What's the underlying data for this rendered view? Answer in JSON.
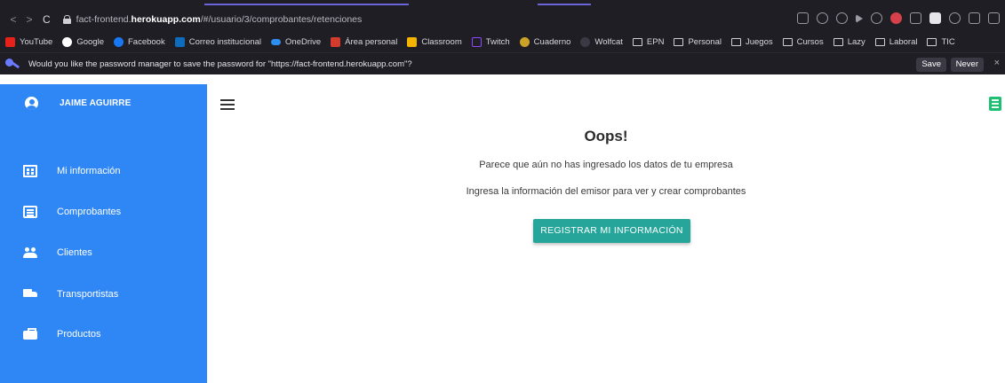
{
  "browser": {
    "url_prefix": "fact-frontend.",
    "url_domain": "herokuapp.com",
    "url_path": "/#/usuario/3/comprobantes/retenciones",
    "bookmarks": [
      "YouTube",
      "Google",
      "Facebook",
      "Correo institucional",
      "OneDrive",
      "Área personal",
      "Classroom",
      "Twitch",
      "Cuaderno",
      "Wolfcat"
    ],
    "bookmark_folders": [
      "EPN",
      "Personal",
      "Juegos",
      "Cursos",
      "Lazy",
      "Laboral",
      "TIC"
    ],
    "password_prompt": "Would you like the password manager to save the password for \"https://fact-frontend.herokuapp.com\"?",
    "save_label": "Save",
    "never_label": "Never",
    "close_glyph": "×",
    "back_glyph": "<",
    "forward_glyph": ">",
    "reload_glyph": "C"
  },
  "sidebar": {
    "user_name": "JAIME AGUIRRE",
    "items": [
      {
        "label": "Mi información",
        "icon": "building-icon"
      },
      {
        "label": "Comprobantes",
        "icon": "document-icon"
      },
      {
        "label": "Clientes",
        "icon": "people-icon"
      },
      {
        "label": "Transportistas",
        "icon": "truck-icon"
      },
      {
        "label": "Productos",
        "icon": "briefcase-icon"
      }
    ]
  },
  "main": {
    "title": "Oops!",
    "message_1": "Parece que aún no has ingresado los datos de tu empresa",
    "message_2": "Ingresa la información del emisor para ver y crear comprobantes",
    "register_button": "REGISTRAR MI INFORMACIÓN"
  },
  "colors": {
    "sidebar": "#2f86f5",
    "button": "#26a69a",
    "browser_chrome": "#1f1e25"
  }
}
